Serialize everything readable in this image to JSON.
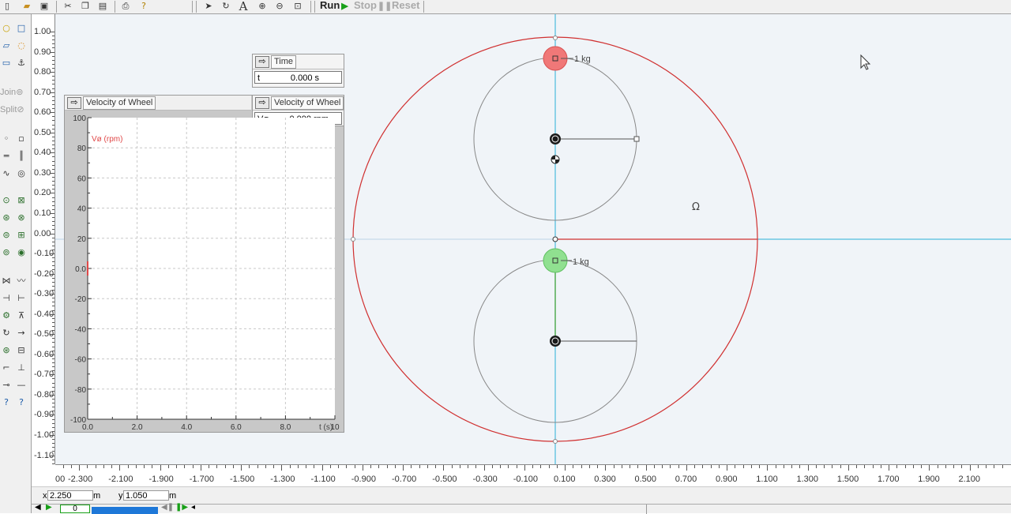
{
  "toolbar": {
    "run_label": "Run",
    "stop_label": "Stop",
    "reset_label": "Reset",
    "text_tool_glyph": "A"
  },
  "palette": {
    "join_label": "Join",
    "split_label": "Split"
  },
  "vertical_ruler": {
    "labels": [
      "1.00",
      "0.90",
      "0.80",
      "0.70",
      "0.60",
      "0.50",
      "0.40",
      "0.30",
      "0.20",
      "0.10",
      "0.00",
      "-0.10",
      "-0.20",
      "-0.30",
      "-0.40",
      "-0.50",
      "-0.60",
      "-0.70",
      "-0.80",
      "-0.90",
      "-1.00",
      "-1.10"
    ]
  },
  "horizontal_ruler": {
    "labels": [
      "00",
      "-2.300",
      "-2.100",
      "-1.900",
      "-1.700",
      "-1.500",
      "-1.300",
      "-1.100",
      "-0.900",
      "-0.700",
      "-0.500",
      "-0.300",
      "-0.100",
      "0.100",
      "0.300",
      "0.500",
      "0.700",
      "0.900",
      "1.100",
      "1.300",
      "1.500",
      "1.700",
      "1.900",
      "2.100"
    ]
  },
  "status": {
    "x_label": "x",
    "x_value": "2.250",
    "x_unit": "m",
    "y_label": "y",
    "y_value": "1.050",
    "y_unit": "m",
    "frame_value": "0"
  },
  "time_meter": {
    "title": "Time",
    "symbol": "t",
    "value": "0.000 s"
  },
  "velocity_meter": {
    "title": "Velocity of Wheel",
    "symbol": "Vø",
    "value": "0.000 rpm"
  },
  "graph": {
    "title": "Velocity of Wheel",
    "series_label": "Vø (rpm)",
    "x_axis_label": "t (s)",
    "series_color": "#e04848"
  },
  "scene": {
    "top_mass_label": "1 kg",
    "bottom_mass_label": "1 kg",
    "omega_symbol": "Ω",
    "top_mass_color": "#f07878",
    "bottom_mass_color": "#90e090",
    "outer_wheel_color": "#d03030",
    "axis_color": "#2ab0d8"
  },
  "chart_data": {
    "type": "line",
    "title": "Velocity of Wheel",
    "xlabel": "t (s)",
    "ylabel": "Vø (rpm)",
    "xlim": [
      0,
      10
    ],
    "ylim": [
      -100,
      100
    ],
    "x_ticks": [
      "0.0",
      "2.0",
      "4.0",
      "6.0",
      "8.0",
      "10"
    ],
    "y_ticks": [
      "100",
      "80",
      "60",
      "40",
      "20",
      "0.0",
      "-20",
      "-40",
      "-60",
      "-80",
      "-100"
    ],
    "grid": true,
    "series": [
      {
        "name": "Vø (rpm)",
        "x": [
          0
        ],
        "y": [
          0
        ]
      }
    ]
  }
}
